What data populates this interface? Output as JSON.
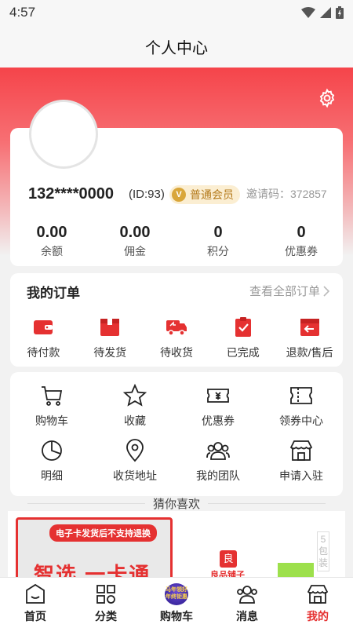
{
  "status": {
    "time": "4:57"
  },
  "header": {
    "title": "个人中心"
  },
  "profile": {
    "phone": "132****0000",
    "uid": "(ID:93)",
    "member_level": "普通会员",
    "member_badge_letter": "V",
    "invite": "邀请码：372857"
  },
  "stats": [
    {
      "value": "0.00",
      "label": "余额"
    },
    {
      "value": "0.00",
      "label": "佣金"
    },
    {
      "value": "0",
      "label": "积分"
    },
    {
      "value": "0",
      "label": "优惠券"
    }
  ],
  "orders": {
    "title": "我的订单",
    "view_all": "查看全部订单",
    "items": [
      {
        "label": "待付款",
        "icon": "wallet-icon"
      },
      {
        "label": "待发货",
        "icon": "box-icon"
      },
      {
        "label": "待收货",
        "icon": "truck-icon"
      },
      {
        "label": "已完成",
        "icon": "clipboard-check-icon"
      },
      {
        "label": "退款/售后",
        "icon": "refund-icon"
      }
    ]
  },
  "tools": [
    {
      "label": "购物车",
      "icon": "cart-icon"
    },
    {
      "label": "收藏",
      "icon": "star-icon"
    },
    {
      "label": "优惠券",
      "icon": "coupon-icon"
    },
    {
      "label": "领券中心",
      "icon": "ticket-center-icon"
    },
    {
      "label": "明细",
      "icon": "pie-chart-icon"
    },
    {
      "label": "收货地址",
      "icon": "location-icon"
    },
    {
      "label": "我的团队",
      "icon": "team-icon"
    },
    {
      "label": "申请入驻",
      "icon": "shop-icon"
    }
  ],
  "guess": {
    "title": "猜你喜欢"
  },
  "products": {
    "promo_banner": "电子卡发货后不支持退换",
    "promo_title": "智选 一卡通",
    "shop_logo_char": "良",
    "shop_name": "良品铺子",
    "side_tag": "5包装"
  },
  "tabbar": [
    {
      "label": "首页",
      "icon": "home-icon",
      "active": false
    },
    {
      "label": "分类",
      "icon": "category-icon",
      "active": false
    },
    {
      "label": "购物车",
      "icon": "cart-promo-icon",
      "active": false,
      "badge_text": "马年领好 年终钜惠"
    },
    {
      "label": "消息",
      "icon": "message-icon",
      "active": false
    },
    {
      "label": "我的",
      "icon": "my-shop-icon",
      "active": true
    }
  ],
  "colors": {
    "accent": "#e53131",
    "badge_bg": "#fbeed2",
    "badge_text": "#b47a1b"
  }
}
